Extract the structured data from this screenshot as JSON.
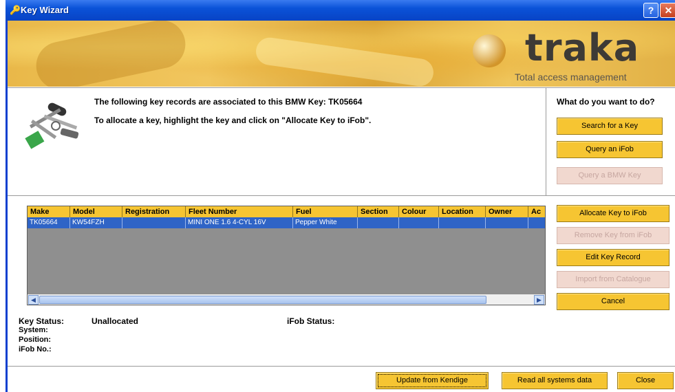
{
  "window": {
    "title": "Key Wizard"
  },
  "banner": {
    "logo": "traka",
    "tagline": "Total access management"
  },
  "message": {
    "line1": "The following key records are associated to this BMW Key: TK05664",
    "line2": "To allocate a key, highlight the key and click on \"Allocate Key to iFob\"."
  },
  "actions": {
    "heading": "What do you want to do?",
    "search_key": "Search for a Key",
    "query_ifob": "Query an iFob",
    "query_bmw": "Query a BMW Key"
  },
  "table": {
    "columns": [
      "Make",
      "Model",
      "Registration",
      "Fleet Number",
      "Fuel",
      "Section",
      "Colour",
      "Location",
      "Owner",
      "Ac"
    ],
    "rows": [
      [
        "TK05664",
        "KW54FZH",
        "",
        "MINI ONE 1.6 4-CYL 16V",
        "Pepper White",
        "",
        "",
        "",
        "",
        ""
      ]
    ]
  },
  "key_buttons": {
    "allocate": "Allocate Key to iFob",
    "remove": "Remove Key from iFob",
    "edit": "Edit Key Record",
    "import": "Import from Catalogue",
    "cancel": "Cancel"
  },
  "status": {
    "key_status_label": "Key Status:",
    "key_status_value": "Unallocated",
    "system_label": "System:",
    "position_label": "Position:",
    "ifob_no_label": "iFob No.:",
    "ifob_status_label": "iFob Status:"
  },
  "footer": {
    "update": "Update from Kendige",
    "read_all": "Read all systems data",
    "close": "Close"
  },
  "colors": {
    "accent": "#f6c532",
    "selection": "#2f64c6",
    "titlebar": "#0a52d8"
  }
}
